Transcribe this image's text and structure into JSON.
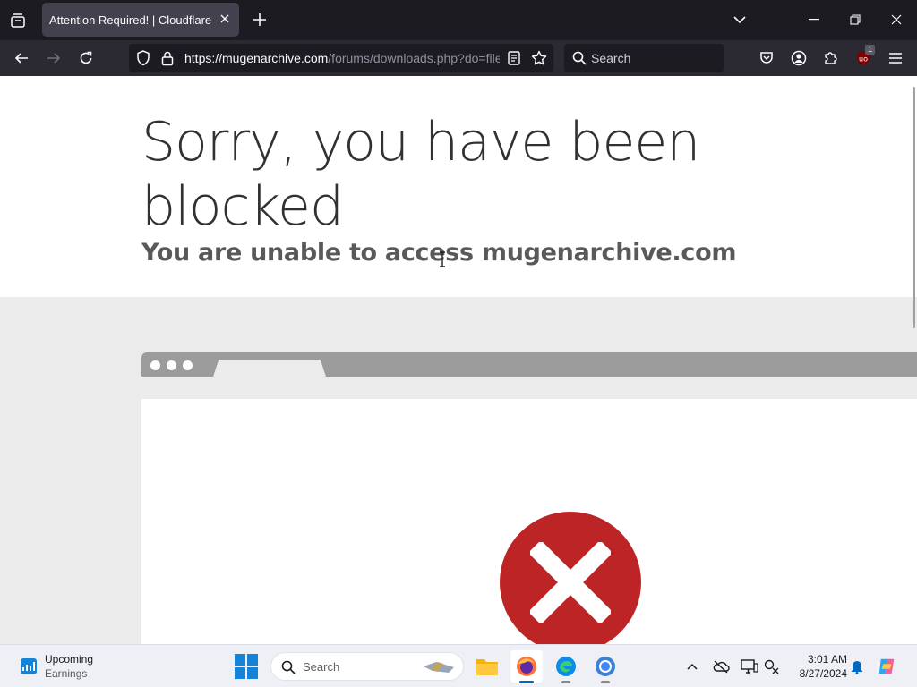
{
  "browser": {
    "tab": {
      "title": "Attention Required! | Cloudflare"
    },
    "url": {
      "host": "https://mugenarchive.com",
      "path": "/forums/downloads.php?do=file"
    },
    "search": {
      "placeholder": "Search"
    },
    "extension_badge": "1"
  },
  "page": {
    "headline": "Sorry, you have been blocked",
    "subline": "You are unable to access mugenarchive.com"
  },
  "colors": {
    "error_red": "#bd2426",
    "browser_frame": "#1c1b22",
    "toolbar": "#2b2a33",
    "accent_blue": "#0067c0"
  },
  "taskbar": {
    "widget": {
      "title": "Upcoming",
      "subtitle": "Earnings"
    },
    "search": {
      "placeholder": "Search"
    },
    "clock": {
      "time": "3:01 AM",
      "date": "8/27/2024"
    }
  }
}
